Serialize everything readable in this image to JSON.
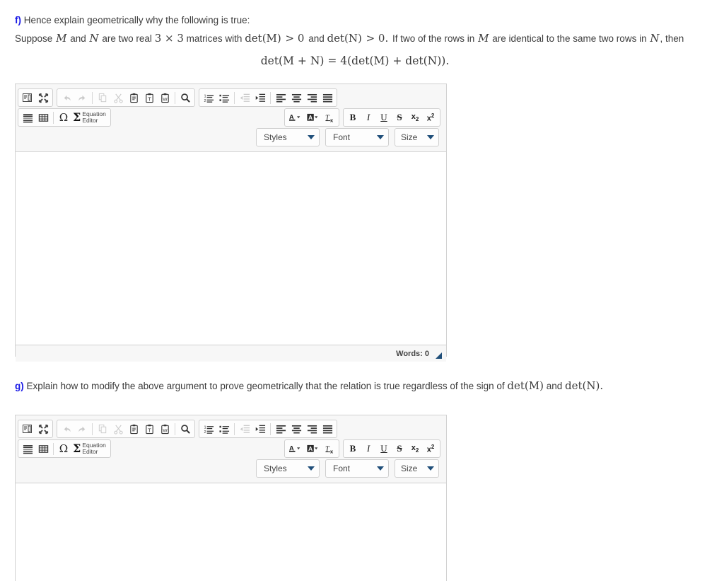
{
  "question_f": {
    "label": "f)",
    "intro": "Hence explain geometrically why the following is true:",
    "body_1": "Suppose",
    "body_m": "M",
    "body_2": "and",
    "body_n": "N",
    "body_3": "are two real",
    "body_3x3": "3 × 3",
    "body_4": "matrices with",
    "body_det_m": "det(M)",
    "body_gt1": "> 0",
    "body_5": "and",
    "body_det_n": "det(N)",
    "body_gt2": "> 0.",
    "body_6": "If two of the rows in",
    "body_m2": "M",
    "body_7": "are identical to the same two rows in",
    "body_n2": "N",
    "body_8": ", then",
    "formula": "det(M + N) = 4(det(M) + det(N))."
  },
  "question_g": {
    "label": "g)",
    "text_1": "Explain how to modify the above argument to prove geometrically that the relation is true regardless of the sign of",
    "det_m": "det(M)",
    "text_2": "and",
    "det_n": "det(N)",
    "text_3": "."
  },
  "editor": {
    "toolbar": {
      "group_doc": [
        {
          "name": "source-icon",
          "title": "Source",
          "disabled": false
        },
        {
          "name": "maximize-icon",
          "title": "Maximize",
          "disabled": false
        }
      ],
      "group_clipboard": [
        {
          "name": "undo-icon",
          "title": "Undo",
          "disabled": true
        },
        {
          "name": "redo-icon",
          "title": "Redo",
          "disabled": true
        },
        {
          "name": "copy-icon",
          "title": "Copy",
          "disabled": true
        },
        {
          "name": "cut-icon",
          "title": "Cut",
          "disabled": true
        },
        {
          "name": "paste-icon",
          "title": "Paste",
          "disabled": false
        },
        {
          "name": "paste-text-icon",
          "title": "Paste as plain text",
          "disabled": false
        },
        {
          "name": "paste-word-icon",
          "title": "Paste from Word",
          "disabled": false
        },
        {
          "name": "find-icon",
          "title": "Find",
          "disabled": false
        }
      ],
      "group_lists": [
        {
          "name": "numbered-list-icon",
          "title": "Insert/Remove Numbered List",
          "disabled": false
        },
        {
          "name": "bulleted-list-icon",
          "title": "Insert/Remove Bulleted List",
          "disabled": false
        },
        {
          "name": "decrease-indent-icon",
          "title": "Decrease Indent",
          "disabled": true
        },
        {
          "name": "increase-indent-icon",
          "title": "Increase Indent",
          "disabled": false
        },
        {
          "name": "align-left-icon",
          "title": "Align Left",
          "disabled": false
        },
        {
          "name": "align-center-icon",
          "title": "Center",
          "disabled": false
        },
        {
          "name": "align-right-icon",
          "title": "Align Right",
          "disabled": false
        },
        {
          "name": "justify-icon",
          "title": "Justify",
          "disabled": false
        }
      ],
      "group_insert": [
        {
          "name": "horizontal-rule-icon",
          "title": "Insert Horizontal Line",
          "disabled": false
        },
        {
          "name": "table-icon",
          "title": "Table",
          "disabled": false
        },
        {
          "name": "special-char-icon",
          "title": "Insert Special Character",
          "disabled": false
        }
      ],
      "equation_editor_label": "Equation\nEditor",
      "group_color": [
        {
          "name": "text-color-icon",
          "title": "Text Color",
          "disabled": false
        },
        {
          "name": "background-color-icon",
          "title": "Background Color",
          "disabled": false
        },
        {
          "name": "remove-format-icon",
          "title": "Remove Format",
          "disabled": false
        }
      ],
      "group_text": [
        {
          "name": "bold-icon",
          "title": "Bold",
          "label": "B",
          "disabled": false
        },
        {
          "name": "italic-icon",
          "title": "Italic",
          "label": "I",
          "disabled": false
        },
        {
          "name": "underline-icon",
          "title": "Underline",
          "label": "U",
          "disabled": false
        },
        {
          "name": "strikethrough-icon",
          "title": "Strike Through",
          "label": "S",
          "disabled": false
        },
        {
          "name": "subscript-icon",
          "title": "Subscript",
          "label": "x₂",
          "disabled": false
        },
        {
          "name": "superscript-icon",
          "title": "Superscript",
          "label": "x²",
          "disabled": false
        }
      ],
      "dropdowns": {
        "styles": "Styles",
        "font": "Font",
        "size": "Size"
      }
    },
    "status": {
      "words_label": "Words: 0"
    },
    "content": ""
  },
  "colors": {
    "question_label": "#1a1ae6",
    "body_text": "#3b3b3b",
    "toolbar_bg": "#f7f7f7",
    "border": "#d1d1d1",
    "accent_navy": "#1f4e79"
  }
}
